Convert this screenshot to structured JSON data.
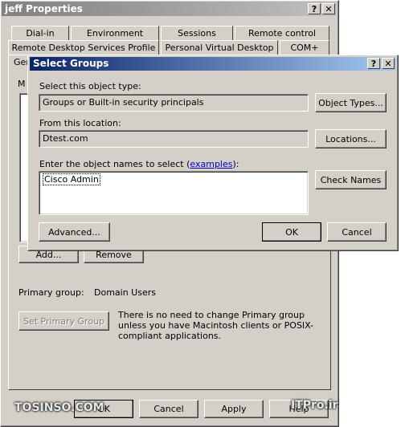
{
  "outer": {
    "title": "jeff Properties",
    "help_btn": "?",
    "close_btn": "✕",
    "tabs_row1": [
      "Dial-in",
      "Environment",
      "Sessions",
      "Remote control"
    ],
    "tabs_row2": [
      "Remote Desktop Services Profile",
      "Personal Virtual Desktop",
      "COM+"
    ],
    "tab_row3_partial": "Gen",
    "member_of_partial": "M",
    "add_button": "Add...",
    "remove_button": "Remove",
    "primary_group_label": "Primary group:",
    "primary_group_value": "Domain Users",
    "set_primary_button": "Set Primary Group",
    "primary_info": "There is no need to change Primary group unless you have Macintosh clients or POSIX-compliant applications.",
    "ok_button": "OK",
    "cancel_button": "Cancel",
    "apply_button": "Apply",
    "help_button": "Help"
  },
  "dialog": {
    "title": "Select Groups",
    "help_btn": "?",
    "close_btn": "✕",
    "object_type_label": "Select this object type:",
    "object_type_value": "Groups or Built-in security principals",
    "object_types_button": "Object Types...",
    "location_label": "From this location:",
    "location_value": "Dtest.com",
    "locations_button": "Locations...",
    "names_label_prefix": "Enter the object names to select (",
    "names_label_link": "examples",
    "names_label_suffix": "):",
    "names_value": "Cisco Admin",
    "check_names_button": "Check Names",
    "advanced_button": "Advanced...",
    "ok_button": "OK",
    "cancel_button": "Cancel"
  },
  "watermark": {
    "left": "TOSINSO.COM",
    "right": "ITPro.ir"
  }
}
